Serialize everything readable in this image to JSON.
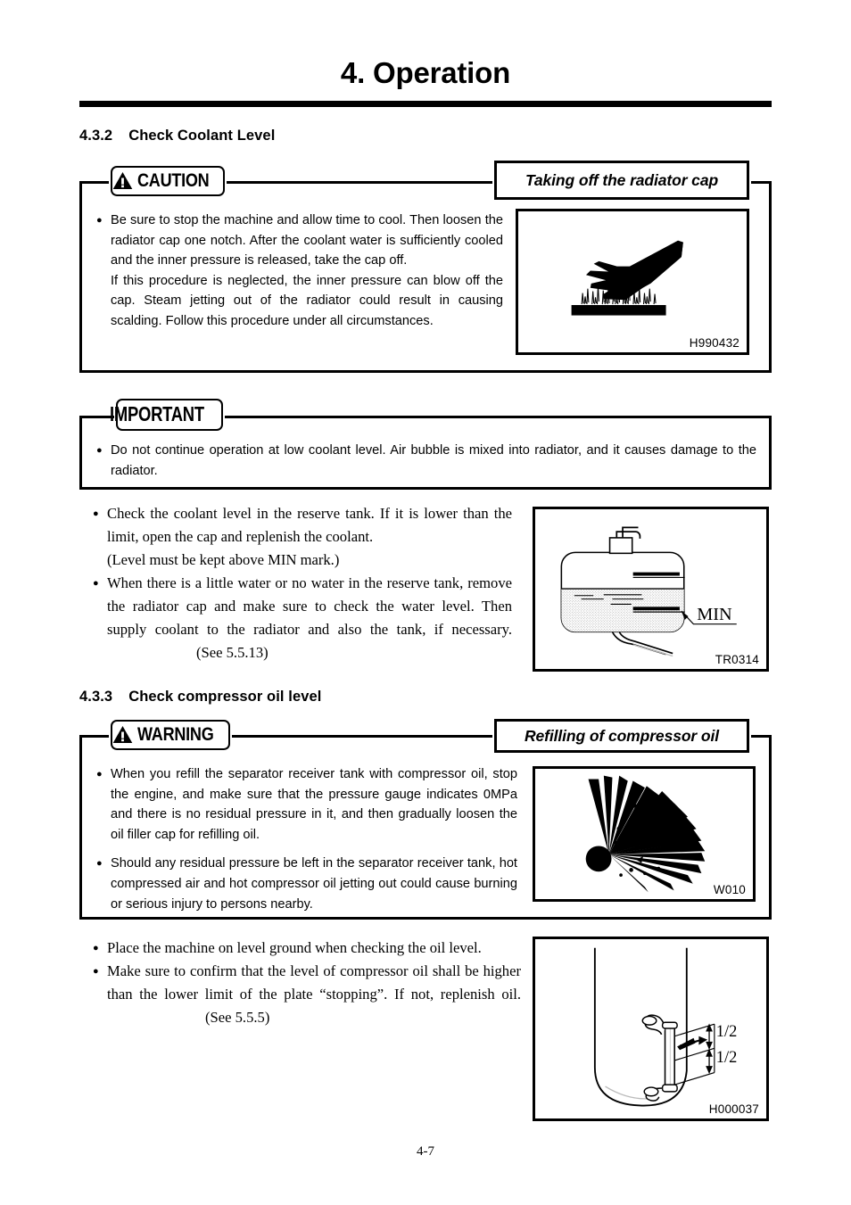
{
  "header": {
    "title": "4. Operation"
  },
  "sections": [
    {
      "number": "4.3.2",
      "title": "Check Coolant Level"
    },
    {
      "number": "4.3.3",
      "title": "Check compressor oil level"
    }
  ],
  "caution_block": {
    "badge_label": "CAUTION",
    "badge_icon": "warning-triangle-icon",
    "title_label": "Taking off the radiator cap",
    "bullets": [
      "Be sure to stop the machine and allow time to cool. Then loosen the radiator cap one notch. After the coolant water is sufficiently cooled and the inner pressure is released, take the cap off.",
      "If this procedure is neglected, the inner pressure can blow off the cap. Steam jetting out of the radiator could result in causing scalding. Follow this procedure under all circumstances."
    ],
    "figure": {
      "code": "H990432",
      "icon": "hot-surface-hand-burn-icon"
    }
  },
  "important_block": {
    "badge_label": "IMPORTANT",
    "bullets": [
      "Do not continue operation at low coolant level. Air bubble is mixed into radiator, and it causes damage to the radiator."
    ]
  },
  "coolant_body": {
    "bullets": [
      {
        "lines": [
          "Check the coolant level in the reserve tank. If it is lower than the limit, open the cap and replenish the coolant.",
          "(Level must be kept above MIN mark.)"
        ]
      },
      {
        "lines": [
          "When there is a little water or no water in the reserve tank, remove the radiator cap and make sure to check the water level. Then supply coolant to the radiator and also the tank, if necessary."
        ],
        "reference": "(See 5.5.13)"
      }
    ],
    "figure": {
      "code": "TR0314",
      "icon": "coolant-reserve-tank-icon",
      "min_label": "MIN"
    }
  },
  "warning_block": {
    "badge_label": "WARNING",
    "badge_icon": "warning-triangle-icon",
    "title_label": "Refilling of compressor oil",
    "bullets": [
      "When you refill the separator receiver tank with compressor oil, stop the engine, and make sure that the pressure gauge indicates 0MPa and there is no residual pressure in it, and then gradually loosen the oil filler cap for refilling oil.",
      "Should any residual pressure be left in the separator receiver tank, hot compressed air and hot compressor oil jetting out could cause burning or serious injury to persons nearby."
    ],
    "figure": {
      "code": "W010",
      "icon": "explosion-burst-icon"
    }
  },
  "oil_body": {
    "bullets": [
      {
        "lines": [
          "Place the machine on level ground when checking the oil level."
        ]
      },
      {
        "lines": [
          "Make sure to confirm that the level of compressor oil shall be higher than the lower limit of the plate “stopping”. If not, replenish oil."
        ],
        "reference": "(See 5.5.5)"
      }
    ],
    "figure": {
      "code": "H000037",
      "icon": "sight-gauge-oil-level-icon",
      "labels": [
        "1/2",
        "1/2"
      ]
    }
  },
  "footer": {
    "page_number": "4-7"
  },
  "colors": {
    "ink": "#000000",
    "paper": "#ffffff",
    "fill_tint": "#d9d9d9"
  }
}
